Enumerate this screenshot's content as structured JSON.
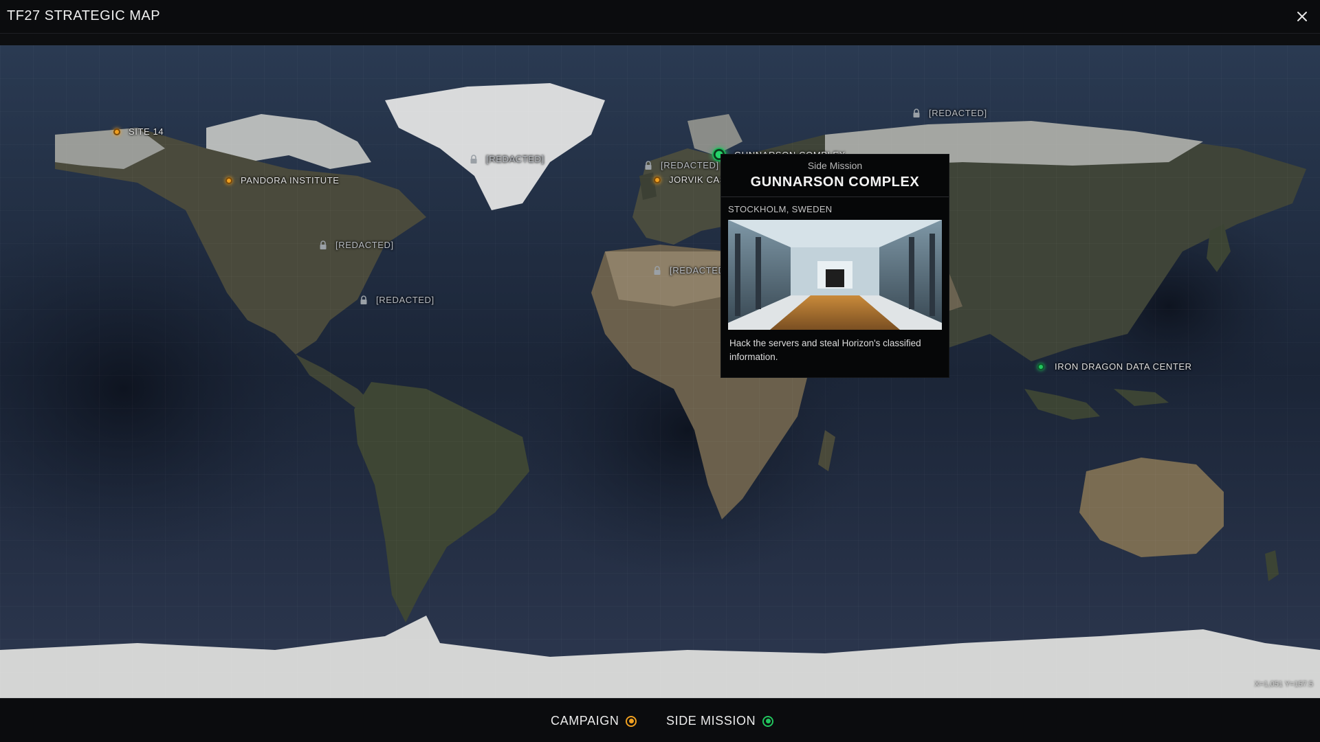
{
  "window": {
    "title": "TF27 STRATEGIC MAP",
    "close_icon": "close-icon"
  },
  "colors": {
    "campaign": "#f0a020",
    "side_mission": "#22c55e"
  },
  "map": {
    "coords_readout": "X=1,051 Y=157.5",
    "markers": {
      "site14": {
        "label": "SITE 14",
        "type": "campaign"
      },
      "pandora": {
        "label": "PANDORA INSTITUTE",
        "type": "campaign"
      },
      "jorvik": {
        "label": "JORVIK CAS",
        "type": "campaign"
      },
      "gunnarson": {
        "label": "GUNNARSON COMPLEX",
        "type": "side_mission"
      },
      "iron_dragon": {
        "label": "IRON DRAGON DATA CENTER",
        "type": "side_mission"
      },
      "redacted_greenland": {
        "label": "[REDACTED]",
        "type": "locked"
      },
      "redacted_usa": {
        "label": "[REDACTED]",
        "type": "locked"
      },
      "redacted_caribbean": {
        "label": "[REDACTED]",
        "type": "locked"
      },
      "redacted_uk": {
        "label": "[REDACTED]",
        "type": "locked"
      },
      "redacted_africa": {
        "label": "[REDACTED]",
        "type": "locked"
      },
      "redacted_russia": {
        "label": "[REDACTED]",
        "type": "locked"
      }
    }
  },
  "popup": {
    "type": "Side Mission",
    "title": "GUNNARSON COMPLEX",
    "location": "STOCKHOLM, SWEDEN",
    "description": "Hack the servers and steal Horizon's classified information."
  },
  "legend": {
    "campaign_label": "CAMPAIGN",
    "side_mission_label": "SIDE MISSION"
  }
}
